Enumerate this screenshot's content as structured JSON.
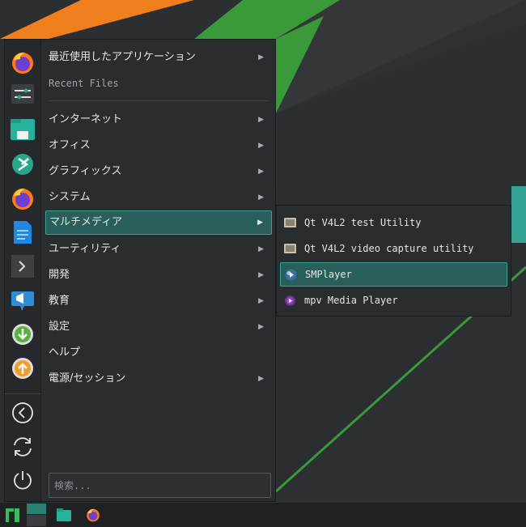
{
  "menu": {
    "categories": [
      {
        "label": "最近使用したアプリケーション",
        "has_submenu": true
      },
      {
        "label": "Recent Files",
        "has_submenu": false
      },
      {
        "label": "インターネット",
        "has_submenu": true
      },
      {
        "label": "オフィス",
        "has_submenu": true
      },
      {
        "label": "グラフィックス",
        "has_submenu": true
      },
      {
        "label": "システム",
        "has_submenu": true
      },
      {
        "label": "マルチメディア",
        "has_submenu": true,
        "active": true
      },
      {
        "label": "ユーティリティ",
        "has_submenu": true
      },
      {
        "label": "開発",
        "has_submenu": true
      },
      {
        "label": "教育",
        "has_submenu": true
      },
      {
        "label": "設定",
        "has_submenu": true
      },
      {
        "label": "ヘルプ",
        "has_submenu": false
      },
      {
        "label": "電源/セッション",
        "has_submenu": true
      }
    ],
    "arrow_glyph": "▶",
    "search": {
      "placeholder": "検索..."
    }
  },
  "favorites": [
    "firefox-icon",
    "settings-manager-icon",
    "file-manager-icon",
    "kvantum-icon",
    "firefox-icon",
    "document-icon",
    "terminal-icon",
    "announcement-icon",
    "download-icon",
    "update-icon",
    "logout-icon",
    "reboot-icon",
    "power-icon"
  ],
  "submenu": {
    "items": [
      {
        "label": "Qt V4L2 test Utility",
        "icon": "qv4l2-icon"
      },
      {
        "label": "Qt V4L2 video capture utility",
        "icon": "qvidcap-icon"
      },
      {
        "label": "SMPlayer",
        "icon": "smplayer-icon",
        "active": true
      },
      {
        "label": "mpv Media Player",
        "icon": "mpv-icon"
      }
    ]
  },
  "taskbar": {
    "items": [
      "manjaro-menu-icon",
      "desktop-pager",
      "file-manager-icon",
      "firefox-icon"
    ]
  },
  "colors": {
    "accent": "#35a293",
    "active_bg": "#285f5a",
    "wallpaper_orange": "#f0801e",
    "wallpaper_green": "#3a9a3a",
    "panel_bg": "#2a2d30"
  }
}
